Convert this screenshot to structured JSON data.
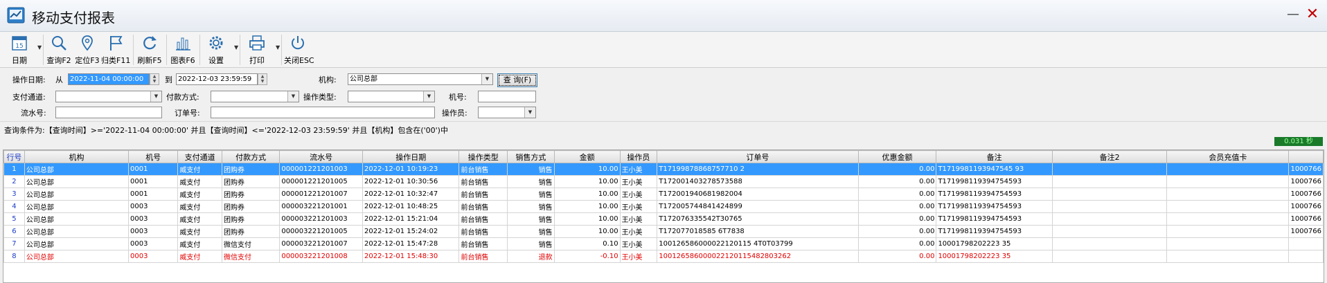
{
  "window": {
    "title": "移动支付报表"
  },
  "toolbar": {
    "date": "日期",
    "query": "查询F2",
    "locate": "定位F3",
    "classify": "归类F11",
    "refresh": "刷新F5",
    "chart": "图表F6",
    "settings": "设置",
    "print": "打印",
    "close": "关闭ESC",
    "calendar_day": "15"
  },
  "filters": {
    "op_date_label": "操作日期:",
    "from_label": "从",
    "from_value": "2022-11-04 00:00:00",
    "to_label": "到",
    "to_value": "2022-12-03 23:59:59",
    "org_label": "机构:",
    "org_value": "公司总部",
    "query_button": "查 询(F)",
    "channel_label": "支付通道:",
    "channel_value": "",
    "pay_method_label": "付款方式:",
    "pay_method_value": "",
    "op_type_label": "操作类型:",
    "op_type_value": "",
    "machine_label": "机号:",
    "machine_value": "",
    "serial_label": "流水号:",
    "serial_value": "",
    "order_label": "订单号:",
    "order_value": "",
    "operator_label": "操作员:",
    "operator_value": ""
  },
  "condition_text": "查询条件为:【查询时间】>='2022-11-04 00:00:00' 并且【查询时间】<='2022-12-03 23:59:59' 并且【机构】包含在('00')中",
  "timer": "0.031 秒",
  "grid": {
    "columns": [
      "行号",
      "机构",
      "机号",
      "支付通道",
      "付款方式",
      "流水号",
      "操作日期",
      "操作类型",
      "销售方式",
      "金额",
      "操作员",
      "订单号",
      "优惠金额",
      "备注",
      "备注2",
      "会员充值卡",
      ""
    ],
    "rows": [
      [
        "1",
        "公司总部",
        "0001",
        "威支付",
        "团购券",
        "000001221201003",
        "2022-12-01 10:19:23",
        "前台销售",
        "销售",
        "10.00",
        "王小美",
        "T17199878868757710 2",
        "0.00",
        "T1719981193947545 93",
        "",
        "",
        "1000766"
      ],
      [
        "2",
        "公司总部",
        "0001",
        "威支付",
        "团购券",
        "000001221201005",
        "2022-12-01 10:30:56",
        "前台销售",
        "销售",
        "10.00",
        "王小美",
        "T172001403278573588",
        "0.00",
        "T171998119394754593",
        "",
        "",
        "1000766"
      ],
      [
        "3",
        "公司总部",
        "0001",
        "威支付",
        "团购券",
        "000001221201007",
        "2022-12-01 10:32:47",
        "前台销售",
        "销售",
        "10.00",
        "王小美",
        "T172001940681982004",
        "0.00",
        "T171998119394754593",
        "",
        "",
        "1000766"
      ],
      [
        "4",
        "公司总部",
        "0003",
        "威支付",
        "团购券",
        "000003221201001",
        "2022-12-01 10:48:25",
        "前台销售",
        "销售",
        "10.00",
        "王小美",
        "T172005744841424899",
        "0.00",
        "T171998119394754593",
        "",
        "",
        "1000766"
      ],
      [
        "5",
        "公司总部",
        "0003",
        "威支付",
        "团购券",
        "000003221201003",
        "2022-12-01 15:21:04",
        "前台销售",
        "销售",
        "10.00",
        "王小美",
        "T172076335542T30765",
        "0.00",
        "T171998119394754593",
        "",
        "",
        "1000766"
      ],
      [
        "6",
        "公司总部",
        "0003",
        "威支付",
        "团购券",
        "000003221201005",
        "2022-12-01 15:24:02",
        "前台销售",
        "销售",
        "10.00",
        "王小美",
        "T172077018585 6T7838",
        "0.00",
        "T171998119394754593",
        "",
        "",
        "1000766"
      ],
      [
        "7",
        "公司总部",
        "0003",
        "威支付",
        "微信支付",
        "000003221201007",
        "2022-12-01 15:47:28",
        "前台销售",
        "销售",
        "0.10",
        "王小美",
        "100126586000022120115 4T0T03799",
        "0.00",
        "10001798202223 35",
        "",
        "",
        ""
      ],
      [
        "8",
        "公司总部",
        "0003",
        "威支付",
        "微信支付",
        "000003221201008",
        "2022-12-01 15:48:30",
        "前台销售",
        "退款",
        "-0.10",
        "王小美",
        "100126586000022120115482803262",
        "0.00",
        "10001798202223 35",
        "",
        "",
        ""
      ]
    ]
  }
}
